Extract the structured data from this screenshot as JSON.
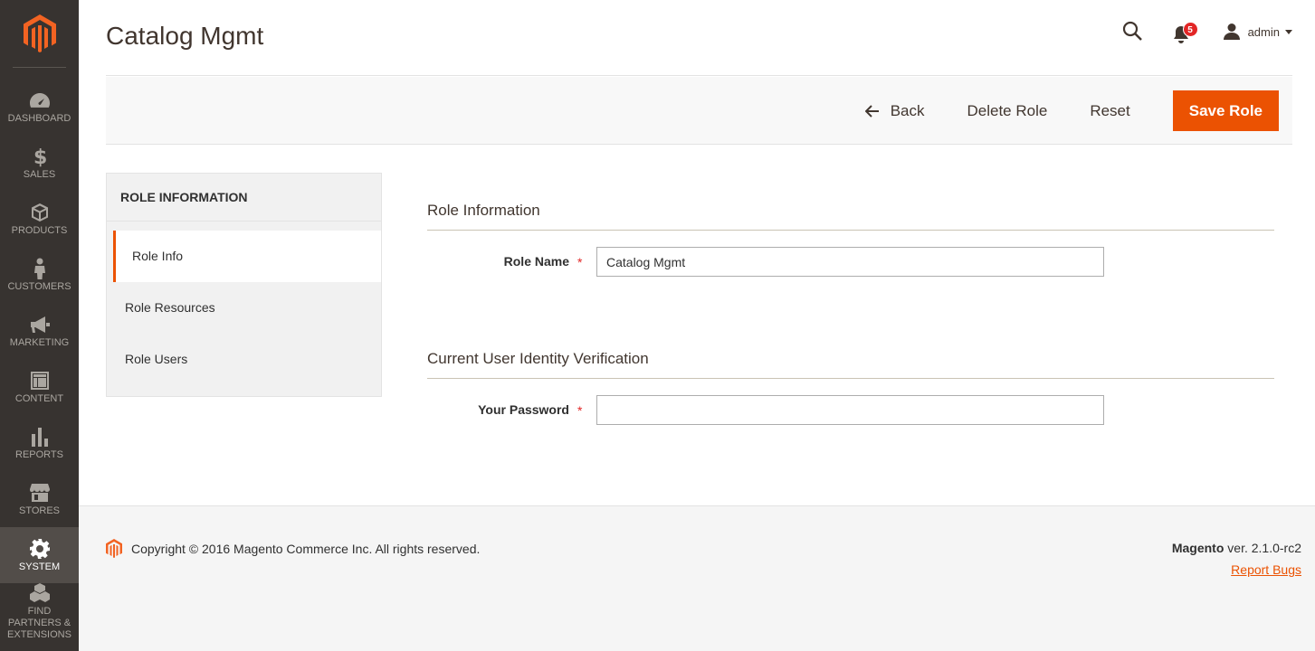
{
  "sidebar": {
    "items": [
      {
        "label": "DASHBOARD",
        "icon": "dashboard-icon"
      },
      {
        "label": "SALES",
        "icon": "dollar-icon"
      },
      {
        "label": "PRODUCTS",
        "icon": "box-icon"
      },
      {
        "label": "CUSTOMERS",
        "icon": "person-icon"
      },
      {
        "label": "MARKETING",
        "icon": "megaphone-icon"
      },
      {
        "label": "CONTENT",
        "icon": "layout-icon"
      },
      {
        "label": "REPORTS",
        "icon": "bar-chart-icon"
      },
      {
        "label": "STORES",
        "icon": "storefront-icon"
      },
      {
        "label": "SYSTEM",
        "icon": "gear-icon",
        "active": true
      },
      {
        "label": "FIND PARTNERS & EXTENSIONS",
        "icon": "blocks-icon"
      }
    ]
  },
  "header": {
    "title": "Catalog Mgmt",
    "notifications_count": "5",
    "user": "admin"
  },
  "toolbar": {
    "back_label": "Back",
    "delete_label": "Delete Role",
    "reset_label": "Reset",
    "save_label": "Save Role"
  },
  "tabs": {
    "title": "ROLE INFORMATION",
    "items": [
      "Role Info",
      "Role Resources",
      "Role Users"
    ]
  },
  "form": {
    "role_section": "Role Information",
    "role_name_label": "Role Name",
    "role_name_value": "Catalog Mgmt",
    "verify_section": "Current User Identity Verification",
    "password_label": "Your Password",
    "password_value": "",
    "required_mark": "*"
  },
  "footer": {
    "copyright": "Copyright © 2016 Magento Commerce Inc. All rights reserved.",
    "brand": "Magento",
    "version": " ver. 2.1.0-rc2",
    "report_bugs": "Report Bugs"
  },
  "colors": {
    "accent": "#eb5202",
    "sidebar_bg": "#373330",
    "badge": "#e22626"
  }
}
